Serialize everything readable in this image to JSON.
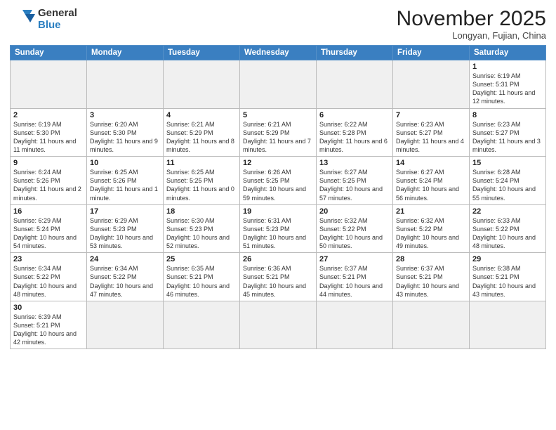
{
  "header": {
    "logo_general": "General",
    "logo_blue": "Blue",
    "month_title": "November 2025",
    "subtitle": "Longyan, Fujian, China"
  },
  "weekdays": [
    "Sunday",
    "Monday",
    "Tuesday",
    "Wednesday",
    "Thursday",
    "Friday",
    "Saturday"
  ],
  "weeks": [
    [
      {
        "day": "",
        "empty": true
      },
      {
        "day": "",
        "empty": true
      },
      {
        "day": "",
        "empty": true
      },
      {
        "day": "",
        "empty": true
      },
      {
        "day": "",
        "empty": true
      },
      {
        "day": "",
        "empty": true
      },
      {
        "day": "1",
        "info": "Sunrise: 6:19 AM\nSunset: 5:31 PM\nDaylight: 11 hours and 12 minutes."
      }
    ],
    [
      {
        "day": "2",
        "info": "Sunrise: 6:19 AM\nSunset: 5:30 PM\nDaylight: 11 hours and 11 minutes."
      },
      {
        "day": "3",
        "info": "Sunrise: 6:20 AM\nSunset: 5:30 PM\nDaylight: 11 hours and 9 minutes."
      },
      {
        "day": "4",
        "info": "Sunrise: 6:21 AM\nSunset: 5:29 PM\nDaylight: 11 hours and 8 minutes."
      },
      {
        "day": "5",
        "info": "Sunrise: 6:21 AM\nSunset: 5:29 PM\nDaylight: 11 hours and 7 minutes."
      },
      {
        "day": "6",
        "info": "Sunrise: 6:22 AM\nSunset: 5:28 PM\nDaylight: 11 hours and 6 minutes."
      },
      {
        "day": "7",
        "info": "Sunrise: 6:23 AM\nSunset: 5:27 PM\nDaylight: 11 hours and 4 minutes."
      },
      {
        "day": "8",
        "info": "Sunrise: 6:23 AM\nSunset: 5:27 PM\nDaylight: 11 hours and 3 minutes."
      }
    ],
    [
      {
        "day": "9",
        "info": "Sunrise: 6:24 AM\nSunset: 5:26 PM\nDaylight: 11 hours and 2 minutes."
      },
      {
        "day": "10",
        "info": "Sunrise: 6:25 AM\nSunset: 5:26 PM\nDaylight: 11 hours and 1 minute."
      },
      {
        "day": "11",
        "info": "Sunrise: 6:25 AM\nSunset: 5:25 PM\nDaylight: 11 hours and 0 minutes."
      },
      {
        "day": "12",
        "info": "Sunrise: 6:26 AM\nSunset: 5:25 PM\nDaylight: 10 hours and 59 minutes."
      },
      {
        "day": "13",
        "info": "Sunrise: 6:27 AM\nSunset: 5:25 PM\nDaylight: 10 hours and 57 minutes."
      },
      {
        "day": "14",
        "info": "Sunrise: 6:27 AM\nSunset: 5:24 PM\nDaylight: 10 hours and 56 minutes."
      },
      {
        "day": "15",
        "info": "Sunrise: 6:28 AM\nSunset: 5:24 PM\nDaylight: 10 hours and 55 minutes."
      }
    ],
    [
      {
        "day": "16",
        "info": "Sunrise: 6:29 AM\nSunset: 5:24 PM\nDaylight: 10 hours and 54 minutes."
      },
      {
        "day": "17",
        "info": "Sunrise: 6:29 AM\nSunset: 5:23 PM\nDaylight: 10 hours and 53 minutes."
      },
      {
        "day": "18",
        "info": "Sunrise: 6:30 AM\nSunset: 5:23 PM\nDaylight: 10 hours and 52 minutes."
      },
      {
        "day": "19",
        "info": "Sunrise: 6:31 AM\nSunset: 5:23 PM\nDaylight: 10 hours and 51 minutes."
      },
      {
        "day": "20",
        "info": "Sunrise: 6:32 AM\nSunset: 5:22 PM\nDaylight: 10 hours and 50 minutes."
      },
      {
        "day": "21",
        "info": "Sunrise: 6:32 AM\nSunset: 5:22 PM\nDaylight: 10 hours and 49 minutes."
      },
      {
        "day": "22",
        "info": "Sunrise: 6:33 AM\nSunset: 5:22 PM\nDaylight: 10 hours and 48 minutes."
      }
    ],
    [
      {
        "day": "23",
        "info": "Sunrise: 6:34 AM\nSunset: 5:22 PM\nDaylight: 10 hours and 48 minutes."
      },
      {
        "day": "24",
        "info": "Sunrise: 6:34 AM\nSunset: 5:22 PM\nDaylight: 10 hours and 47 minutes."
      },
      {
        "day": "25",
        "info": "Sunrise: 6:35 AM\nSunset: 5:21 PM\nDaylight: 10 hours and 46 minutes."
      },
      {
        "day": "26",
        "info": "Sunrise: 6:36 AM\nSunset: 5:21 PM\nDaylight: 10 hours and 45 minutes."
      },
      {
        "day": "27",
        "info": "Sunrise: 6:37 AM\nSunset: 5:21 PM\nDaylight: 10 hours and 44 minutes."
      },
      {
        "day": "28",
        "info": "Sunrise: 6:37 AM\nSunset: 5:21 PM\nDaylight: 10 hours and 43 minutes."
      },
      {
        "day": "29",
        "info": "Sunrise: 6:38 AM\nSunset: 5:21 PM\nDaylight: 10 hours and 43 minutes."
      }
    ],
    [
      {
        "day": "30",
        "info": "Sunrise: 6:39 AM\nSunset: 5:21 PM\nDaylight: 10 hours and 42 minutes."
      },
      {
        "day": "",
        "empty": true
      },
      {
        "day": "",
        "empty": true
      },
      {
        "day": "",
        "empty": true
      },
      {
        "day": "",
        "empty": true
      },
      {
        "day": "",
        "empty": true
      },
      {
        "day": "",
        "empty": true
      }
    ]
  ]
}
